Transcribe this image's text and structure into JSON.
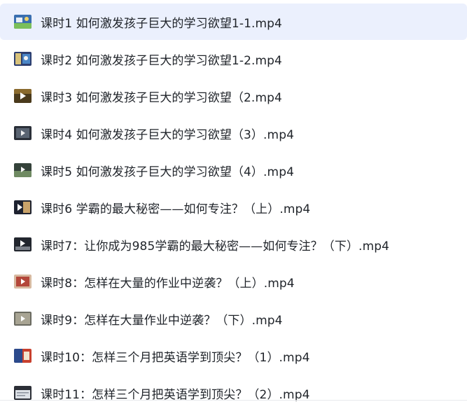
{
  "files": [
    {
      "name": "课时1 如何激发孩子巨大的学习欲望1-1.mp4",
      "thumb_icon": "video-thumbnail-icon",
      "selected": true
    },
    {
      "name": "课时2 如何激发孩子巨大的学习欲望1-2.mp4",
      "thumb_icon": "video-thumbnail-icon",
      "selected": false
    },
    {
      "name": "课时3 如何激发孩子巨大的学习欲望（2.mp4",
      "thumb_icon": "video-thumbnail-icon",
      "selected": false
    },
    {
      "name": "课时4 如何激发孩子巨大的学习欲望（3）.mp4",
      "thumb_icon": "video-thumbnail-icon",
      "selected": false
    },
    {
      "name": "课时5 如何激发孩子巨大的学习欲望（4）.mp4",
      "thumb_icon": "video-thumbnail-icon",
      "selected": false
    },
    {
      "name": "课时6 学霸的最大秘密——如何专注？（上）.mp4",
      "thumb_icon": "video-thumbnail-icon",
      "selected": false
    },
    {
      "name": "课时7：让你成为985学霸的最大秘密——如何专注？（下）.mp4",
      "thumb_icon": "video-thumbnail-icon",
      "selected": false
    },
    {
      "name": "课时8：怎样在大量的作业中逆袭？（上）.mp4",
      "thumb_icon": "video-thumbnail-icon",
      "selected": false
    },
    {
      "name": "课时9：怎样在大量作业中逆袭？（下）.mp4",
      "thumb_icon": "video-thumbnail-icon",
      "selected": false
    },
    {
      "name": "课时10：怎样三个月把英语学到顶尖？（1）.mp4",
      "thumb_icon": "video-thumbnail-icon",
      "selected": false
    },
    {
      "name": "课时11：怎样三个月把英语学到顶尖？（2）.mp4",
      "thumb_icon": "video-thumbnail-icon",
      "selected": false
    }
  ],
  "colors": {
    "selected_bg": "#ebf0fd",
    "text": "#1f2329"
  }
}
